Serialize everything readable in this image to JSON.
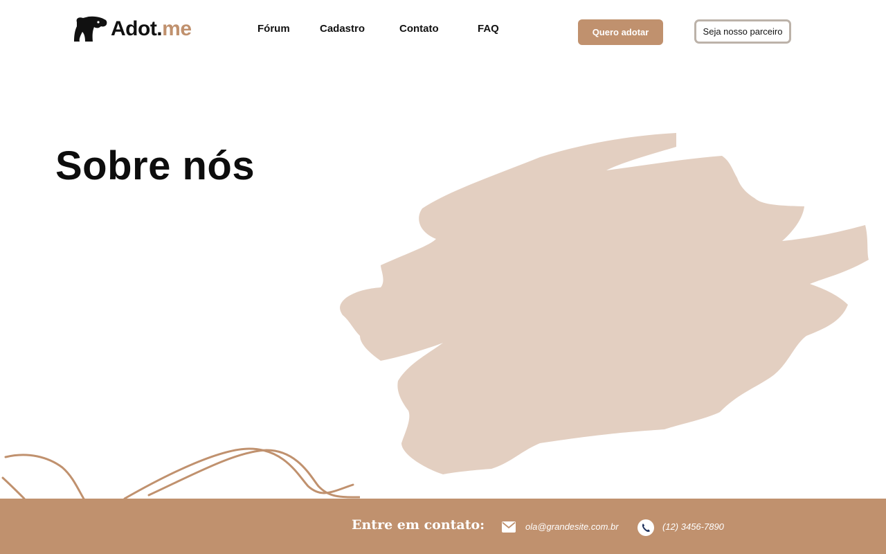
{
  "brand": {
    "logo_icon": "dog-head-icon",
    "name_part1": "Adot.",
    "name_part2": "me",
    "colors": {
      "accent": "#c0916e",
      "dark": "#111111",
      "blob": "#e3cfc1",
      "partner_border": "#bcb2a9"
    }
  },
  "nav": {
    "items": [
      {
        "label": "Fórum"
      },
      {
        "label": "Cadastro"
      },
      {
        "label": "Contato"
      },
      {
        "label": "FAQ"
      }
    ]
  },
  "header_actions": {
    "adopt_label": "Quero adotar",
    "partner_label": "Seja nosso parceiro"
  },
  "hero": {
    "title": "Sobre nós"
  },
  "footer": {
    "title": "Entre em contato:",
    "email_icon": "mail-icon",
    "email": "ola@grandesite.com.br",
    "phone_icon": "phone-icon",
    "phone": "(12) 3456-7890"
  }
}
